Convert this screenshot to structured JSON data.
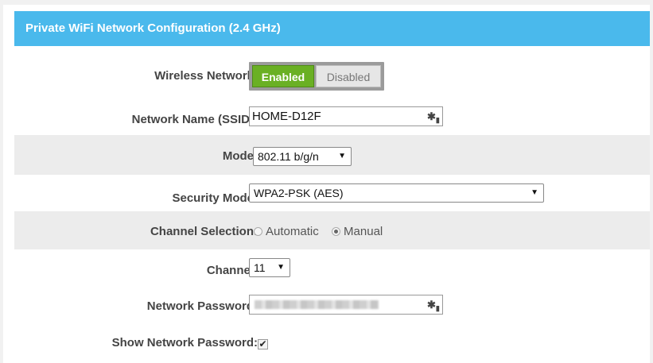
{
  "panel": {
    "title": "Private WiFi Network Configuration (2.4 GHz)"
  },
  "wireless": {
    "label": "Wireless Network:",
    "enabled_label": "Enabled",
    "disabled_label": "Disabled",
    "state": "Enabled"
  },
  "ssid": {
    "label": "Network Name (SSID):",
    "value": "HOME-D12F",
    "icon": "key-icon"
  },
  "mode": {
    "label": "Mode:",
    "value": "802.11 b/g/n"
  },
  "security": {
    "label": "Security Mode:",
    "value": "WPA2-PSK (AES)"
  },
  "channel_selection": {
    "label": "Channel Selection:",
    "options": [
      "Automatic",
      "Manual"
    ],
    "selected": "Manual"
  },
  "channel": {
    "label": "Channel:",
    "value": "11"
  },
  "password": {
    "label": "Network Password:",
    "icon": "key-icon"
  },
  "show_password": {
    "label": "Show Network Password:",
    "checked": true,
    "check_glyph": "✔"
  },
  "colors": {
    "header": "#4ab9ec",
    "enabled": "#6ab024",
    "shade": "#ececec"
  }
}
